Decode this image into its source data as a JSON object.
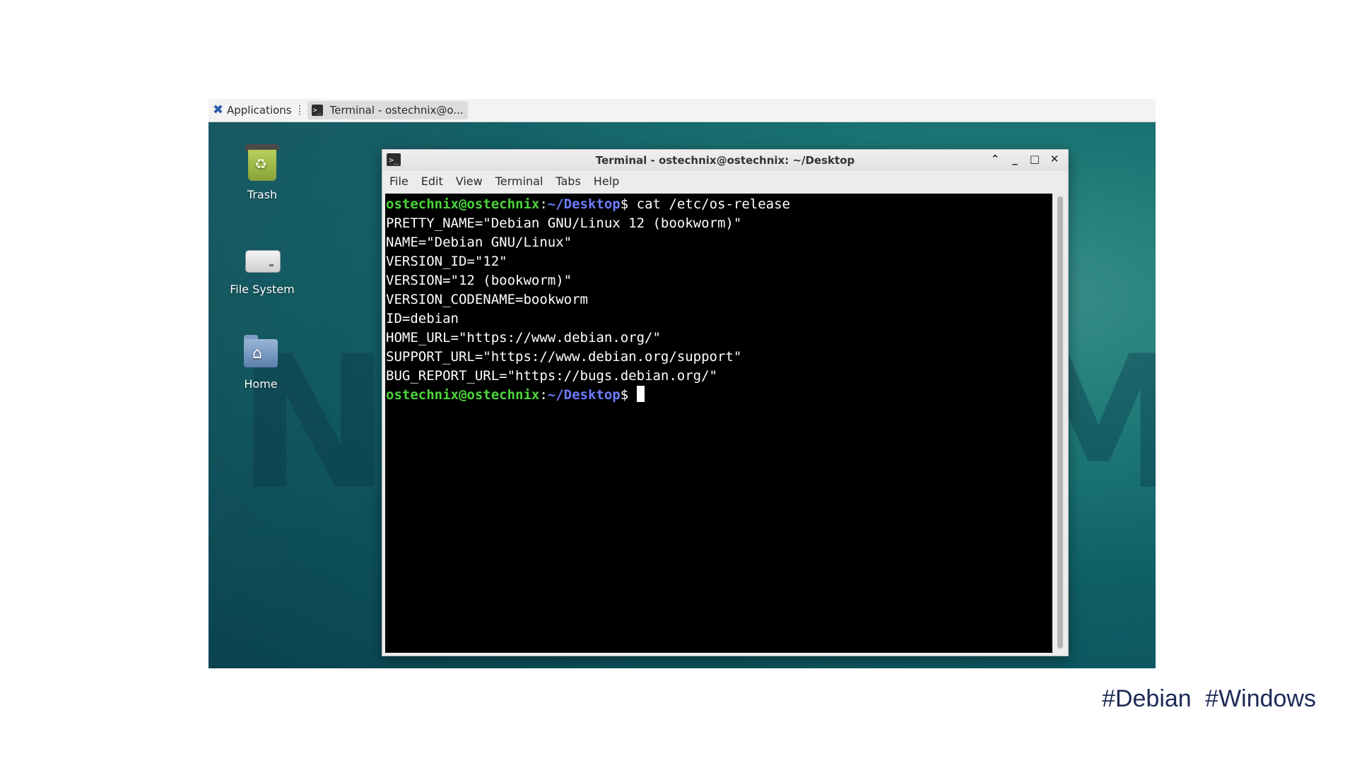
{
  "panel": {
    "applications_label": "Applications",
    "task_label": "Terminal - ostechnix@o...",
    "task_icon_glyph": ">_"
  },
  "desktop_icons": [
    {
      "label": "Trash",
      "icon": "trash-icon"
    },
    {
      "label": "File System",
      "icon": "drive-icon"
    },
    {
      "label": "Home",
      "icon": "home-folder-icon"
    }
  ],
  "terminal": {
    "title": "Terminal - ostechnix@ostechnix: ~/Desktop",
    "title_icon_glyph": ">_",
    "menu": [
      "File",
      "Edit",
      "View",
      "Terminal",
      "Tabs",
      "Help"
    ],
    "prompt_user": "ostechnix@ostechnix",
    "prompt_sep": ":",
    "prompt_path": "~/Desktop",
    "prompt_dollar": "$",
    "command": " cat /etc/os-release",
    "output": [
      "PRETTY_NAME=\"Debian GNU/Linux 12 (bookworm)\"",
      "NAME=\"Debian GNU/Linux\"",
      "VERSION_ID=\"12\"",
      "VERSION=\"12 (bookworm)\"",
      "VERSION_CODENAME=bookworm",
      "ID=debian",
      "HOME_URL=\"https://www.debian.org/\"",
      "SUPPORT_URL=\"https://www.debian.org/support\"",
      "BUG_REPORT_URL=\"https://bugs.debian.org/\""
    ],
    "colors": {
      "user": "#4cd43a",
      "path": "#6d7cff",
      "background": "#000000"
    }
  },
  "footer": {
    "tags": "#Debian #Windows"
  }
}
